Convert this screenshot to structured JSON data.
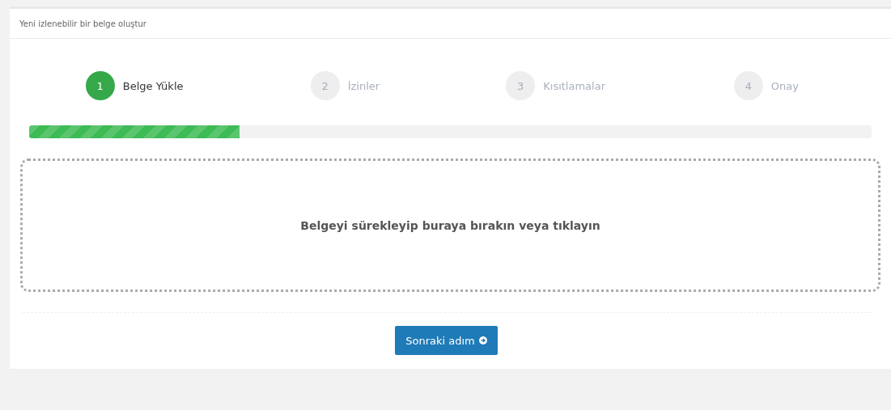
{
  "panel": {
    "title": "Yeni izlenebilir bir belge oluştur"
  },
  "steps": [
    {
      "number": "1",
      "label": "Belge Yükle",
      "selected": true
    },
    {
      "number": "2",
      "label": "İzinler",
      "selected": false
    },
    {
      "number": "3",
      "label": "Kısıtlamalar",
      "selected": false
    },
    {
      "number": "4",
      "label": "Onay",
      "selected": false
    }
  ],
  "progress": {
    "level": 0.25
  },
  "dropzone": {
    "text": "Belgeyi sürekleyip buraya bırakın veya tıklayın"
  },
  "next_button": {
    "label": "Sonraki adım"
  }
}
